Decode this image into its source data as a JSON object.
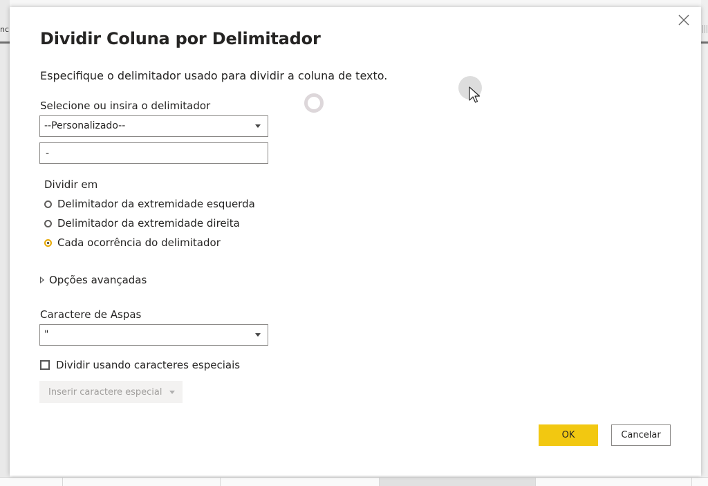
{
  "background": {
    "column_header_fragment": "nc"
  },
  "dialog": {
    "title": "Dividir Coluna por Delimitador",
    "subtitle": "Especifique o delimitador usado para dividir a coluna de texto.",
    "delimiter": {
      "label": "Selecione ou insira o delimitador",
      "selected": "--Personalizado--",
      "custom_value": "-"
    },
    "split_at": {
      "label": "Dividir em",
      "options": [
        {
          "label": "Delimitador da extremidade esquerda",
          "checked": false
        },
        {
          "label": "Delimitador da extremidade direita",
          "checked": false
        },
        {
          "label": "Cada ocorrência do delimitador",
          "checked": true
        }
      ]
    },
    "advanced_options_label": "Opções avançadas",
    "quote_char": {
      "label": "Caractere de Aspas",
      "selected": "\""
    },
    "special_chars": {
      "checkbox_label": "Dividir usando caracteres especiais",
      "checked": false,
      "insert_button_label": "Inserir caractere especial"
    },
    "ok_label": "OK",
    "cancel_label": "Cancelar"
  },
  "colors": {
    "accent": "#f2c811",
    "radio_selected": "#e8a800",
    "border": "#8a8886",
    "disabled_text": "#a19f9d"
  },
  "icons": [
    "close-icon",
    "chevron-down-icon",
    "expand-triangle-icon",
    "loading-spinner-icon",
    "mouse-cursor-icon"
  ]
}
